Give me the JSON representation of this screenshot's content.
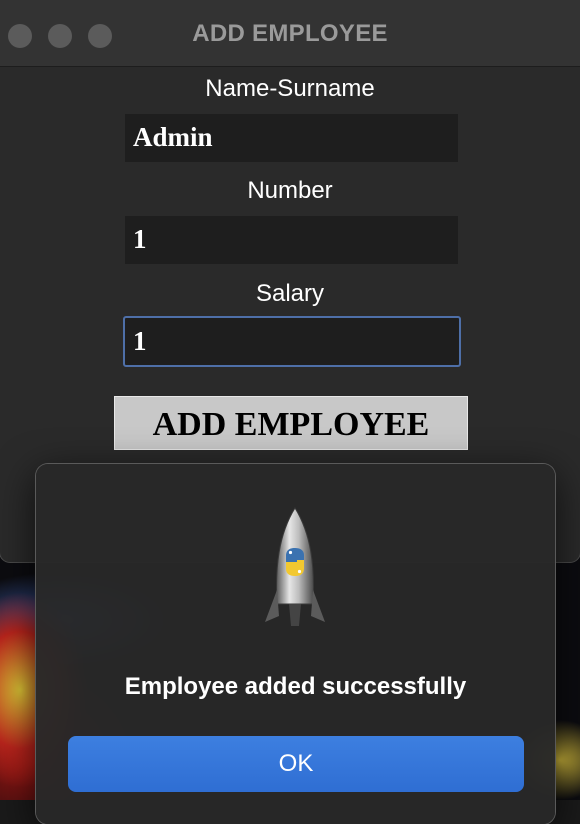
{
  "window": {
    "title": "ADD EMPLOYEE"
  },
  "form": {
    "name_label": "Name-Surname",
    "name_value": "Admin",
    "number_label": "Number",
    "number_value": "1",
    "salary_label": "Salary",
    "salary_value": "1",
    "submit_label": "ADD EMPLOYEE"
  },
  "alert": {
    "icon": "python-launcher-rocket-icon",
    "message": "Employee added successfully",
    "ok_label": "OK"
  },
  "colors": {
    "accent": "#2f6ed3",
    "focus_ring": "#4e6fa8",
    "window_bg": "#2a2a2a",
    "field_bg": "#1e1e1e"
  }
}
